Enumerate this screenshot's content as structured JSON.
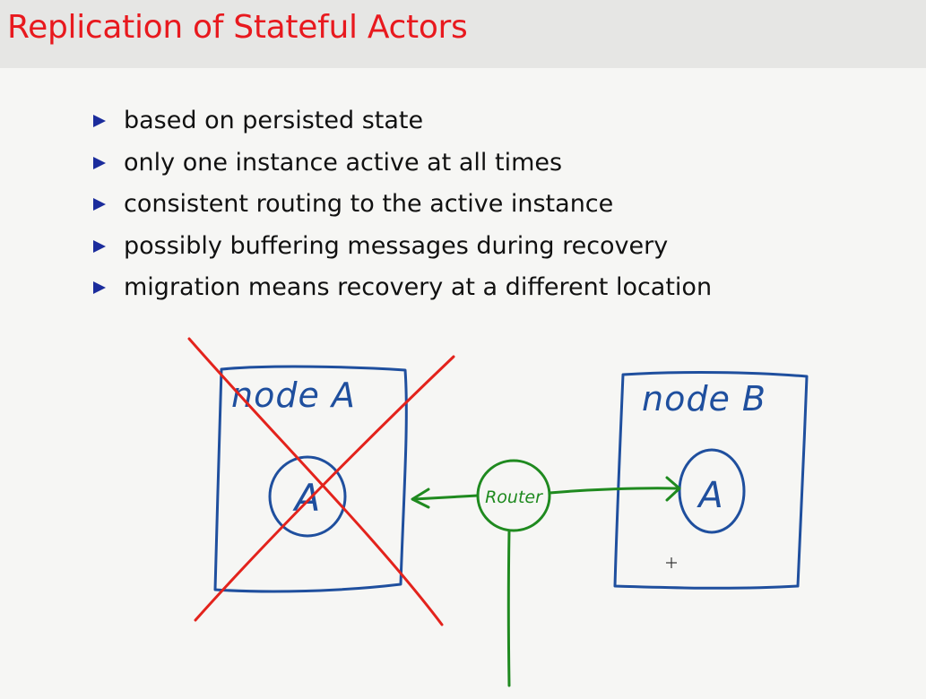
{
  "slide": {
    "title": "Replication of Stateful Actors",
    "bullets": [
      "based on persisted state",
      "only one instance active at all times",
      "consistent routing to the active instance",
      "possibly buffering messages during recovery",
      "migration means recovery at a different location"
    ]
  },
  "diagram": {
    "node_a_label": "node A",
    "node_b_label": "node B",
    "actor_a_label": "A",
    "actor_b_label": "A",
    "router_label": "Router",
    "colors": {
      "ink_blue": "#1f4f9e",
      "ink_green": "#1f8a1f",
      "strike_red": "#e3231c",
      "title_red": "#e8191e",
      "bullet_blue": "#1b2c9c"
    },
    "cursor_icon": "crosshair-icon"
  }
}
